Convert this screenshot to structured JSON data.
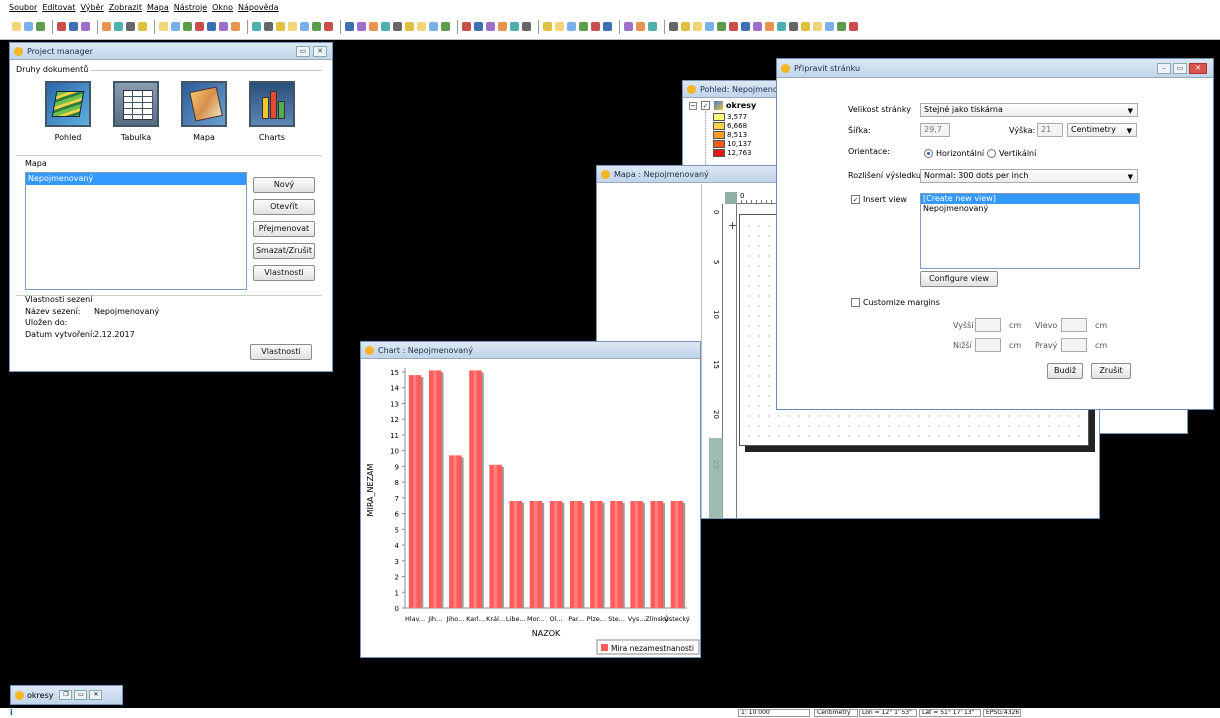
{
  "menu": [
    "Soubor",
    "Editovat",
    "Výběr",
    "Zobrazit",
    "Mapa",
    "Nástroje",
    "Okno",
    "Nápověda"
  ],
  "project_manager": {
    "title": "Project manager",
    "doc_types_label": "Druhy dokumentů",
    "doc_types": [
      {
        "label": "Pohled",
        "icon": "view-icon"
      },
      {
        "label": "Tabulka",
        "icon": "table-icon"
      },
      {
        "label": "Mapa",
        "icon": "map-icon"
      },
      {
        "label": "Charts",
        "icon": "charts-icon"
      }
    ],
    "section_label": "Mapa",
    "items": [
      "Nepojmenovaný"
    ],
    "buttons": {
      "new": "Nový",
      "open": "Otevřít",
      "rename": "Přejmenovat",
      "delete": "Smazat/Zrušit",
      "props": "Vlastnosti"
    },
    "session": {
      "label": "Vlastnosti sezení",
      "name_label": "Název sezení:",
      "name_value": "Nepojmenovaný",
      "saved_label": "Uložen do:",
      "saved_value": "",
      "created_label": "Datum vytvoření:",
      "created_value": "2.12.2017",
      "props_button": "Vlastnosti"
    }
  },
  "view_window": {
    "title": "Pohled: Nepojmeno",
    "layer_name": "okresy",
    "legend": [
      {
        "label": "3,577",
        "color": "#ffff7f"
      },
      {
        "label": "6,668",
        "color": "#ffd04a"
      },
      {
        "label": "8,513",
        "color": "#ff9b2a"
      },
      {
        "label": "10,137",
        "color": "#f85a1a"
      },
      {
        "label": "12,763",
        "color": "#e5161a"
      }
    ]
  },
  "map_window": {
    "title": "Mapa : Nepojmenovaný",
    "ruler_h": [
      "0"
    ],
    "ruler_v": [
      "0",
      "5",
      "10",
      "15",
      "20",
      "25"
    ]
  },
  "chart_window": {
    "title": "Chart : Nepojmenovaný"
  },
  "chart_data": {
    "type": "bar",
    "categories": [
      "Hlav...",
      "Jih...",
      "Jiho...",
      "Karl...",
      "Král...",
      "Libe...",
      "Mor...",
      "Ol...",
      "Par...",
      "Plze...",
      "Ste...",
      "Vys...",
      "Zlínský",
      "Ústecký"
    ],
    "values": [
      14.8,
      15.1,
      9.7,
      15.1,
      9.1,
      6.8,
      6.8,
      6.8,
      6.8,
      6.8,
      6.8,
      6.8,
      6.8,
      6.8
    ],
    "ylabel": "MIRA_NEZAM",
    "xlabel": "NAZOK",
    "ylim": [
      0,
      15
    ],
    "yticks": [
      0,
      1,
      2,
      3,
      4,
      5,
      6,
      7,
      8,
      9,
      10,
      11,
      12,
      13,
      14,
      15
    ],
    "series_name": "Mira nezamestnanosti",
    "bar_color": "#ff5b5b",
    "legend_position": "bottom"
  },
  "page_dialog": {
    "title": "Připravit stránku",
    "page_size_label": "Velikost stránky",
    "page_size_value": "Stejné jako tiskárna",
    "width_label": "Šířka:",
    "width_value": "29,7",
    "height_label": "Výška:",
    "height_value": "21",
    "unit_value": "Centimetry",
    "orientation_label": "Orientace:",
    "orientation_options": [
      "Horizontální",
      "Vertikální"
    ],
    "resolution_label": "Rozlišení výsledku:",
    "resolution_value": "Normal: 300 dots per inch",
    "insert_view_label": "Insert view",
    "views": [
      "[Create new view]",
      "Nepojmenovaný"
    ],
    "configure_view": "Configure view",
    "customize_margins": "Customize margins",
    "margin_top": "Vyšší",
    "margin_left": "Vlevo",
    "margin_bottom": "Nižší",
    "margin_right": "Pravý",
    "unit_cm": "cm",
    "ok": "Budiž",
    "cancel": "Zrušit"
  },
  "taskbar": {
    "label": "okresy"
  },
  "status": {
    "scale": "1: 10 000",
    "units": "Centimetry",
    "lon": "Lon = 12° 1' 53\"",
    "lat": "Lat = 51° 17' 13\"",
    "epsg": "EPSG:4326"
  }
}
